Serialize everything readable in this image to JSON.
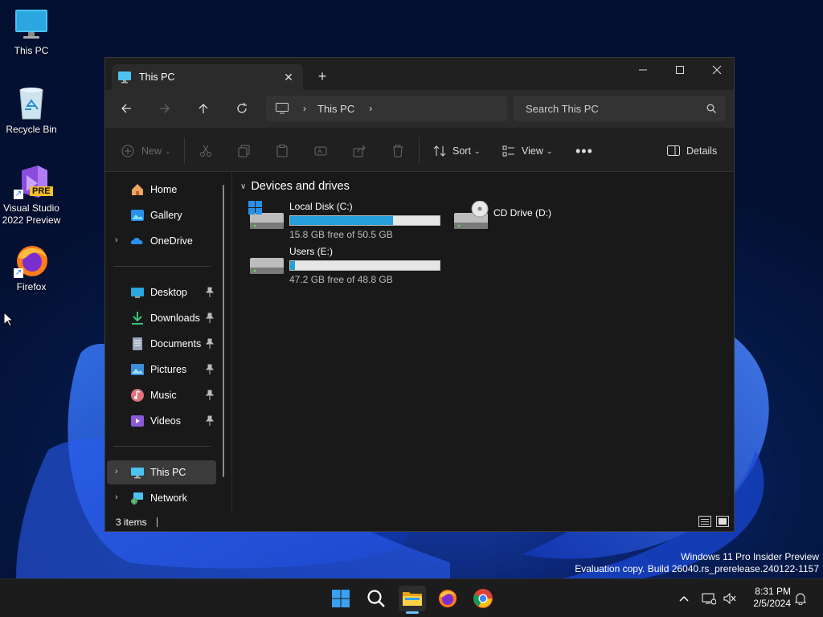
{
  "desktop": {
    "icons": [
      {
        "label": "This PC"
      },
      {
        "label": "Recycle Bin"
      },
      {
        "label": "Visual Studio 2022 Preview",
        "badge": "PRE"
      },
      {
        "label": "Firefox"
      }
    ],
    "watermark": {
      "line1": "Windows 11 Pro Insider Preview",
      "line2": "Evaluation copy. Build 26040.rs_prerelease.240122-1157"
    }
  },
  "window": {
    "tab_title": "This PC",
    "address": {
      "segments": [
        "This PC"
      ]
    },
    "search_placeholder": "Search This PC",
    "commands": {
      "new": "New",
      "sort": "Sort",
      "view": "View",
      "details": "Details"
    },
    "sidebar": {
      "top": [
        {
          "label": "Home",
          "icon": "home-icon"
        },
        {
          "label": "Gallery",
          "icon": "gallery-icon"
        },
        {
          "label": "OneDrive",
          "icon": "onedrive-icon"
        }
      ],
      "quick_access": [
        {
          "label": "Desktop",
          "icon": "desktop-folder-icon"
        },
        {
          "label": "Downloads",
          "icon": "downloads-icon"
        },
        {
          "label": "Documents",
          "icon": "documents-icon"
        },
        {
          "label": "Pictures",
          "icon": "pictures-icon"
        },
        {
          "label": "Music",
          "icon": "music-icon"
        },
        {
          "label": "Videos",
          "icon": "videos-icon"
        }
      ],
      "bottom": [
        {
          "label": "This PC",
          "icon": "this-pc-icon",
          "selected": true
        },
        {
          "label": "Network",
          "icon": "network-icon"
        }
      ]
    },
    "group_header": "Devices and drives",
    "drives": [
      {
        "name": "Local Disk (C:)",
        "free_text": "15.8 GB free of 50.5 GB",
        "used_fraction": 0.687
      },
      {
        "name": "CD Drive (D:)"
      },
      {
        "name": "Users (E:)",
        "free_text": "47.2 GB free of 48.8 GB",
        "used_fraction": 0.033
      }
    ],
    "status": "3 items",
    "colors": {
      "accent": "#26a0da",
      "window_bg": "#191919",
      "titlebar": "#202020",
      "navbar": "#2b2b2b"
    }
  },
  "taskbar": {
    "apps": [
      "start-icon",
      "search-icon",
      "file-explorer-icon",
      "firefox-icon",
      "chrome-icon"
    ],
    "time": "8:31 PM",
    "date": "2/5/2024"
  }
}
